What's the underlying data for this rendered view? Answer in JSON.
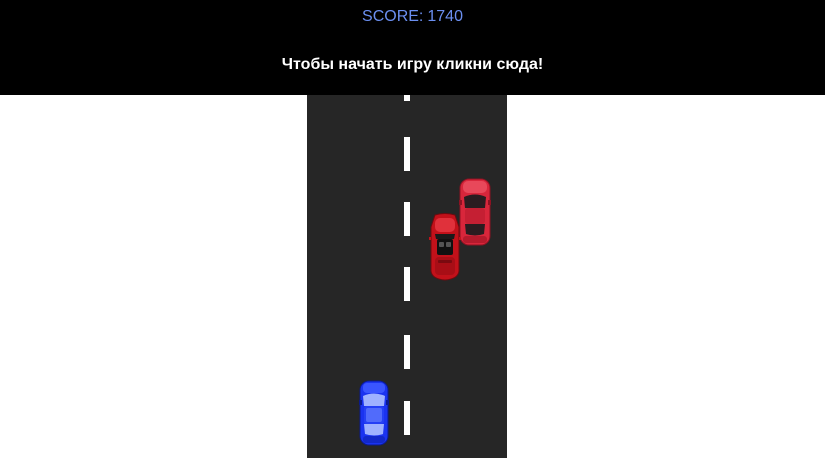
{
  "hud": {
    "score_label": "SCORE:",
    "score_value": "1740",
    "start_message": "Чтобы начать игру кликни сюда!"
  },
  "colors": {
    "header_bg": "#000000",
    "score_text": "#6b8ff0",
    "road": "#262626",
    "lane_line": "#ffffff",
    "player_car": "#1a33f0",
    "enemy_car_sedan": "#d8263b",
    "enemy_car_roadster": "#c2111a"
  },
  "game": {
    "player_car": {
      "name": "player-car",
      "color_ref": "player_car"
    },
    "enemy_cars": [
      {
        "name": "enemy-car-sedan",
        "type": "sedan",
        "color_ref": "enemy_car_sedan"
      },
      {
        "name": "enemy-car-roadster",
        "type": "roadster",
        "color_ref": "enemy_car_roadster"
      }
    ]
  }
}
